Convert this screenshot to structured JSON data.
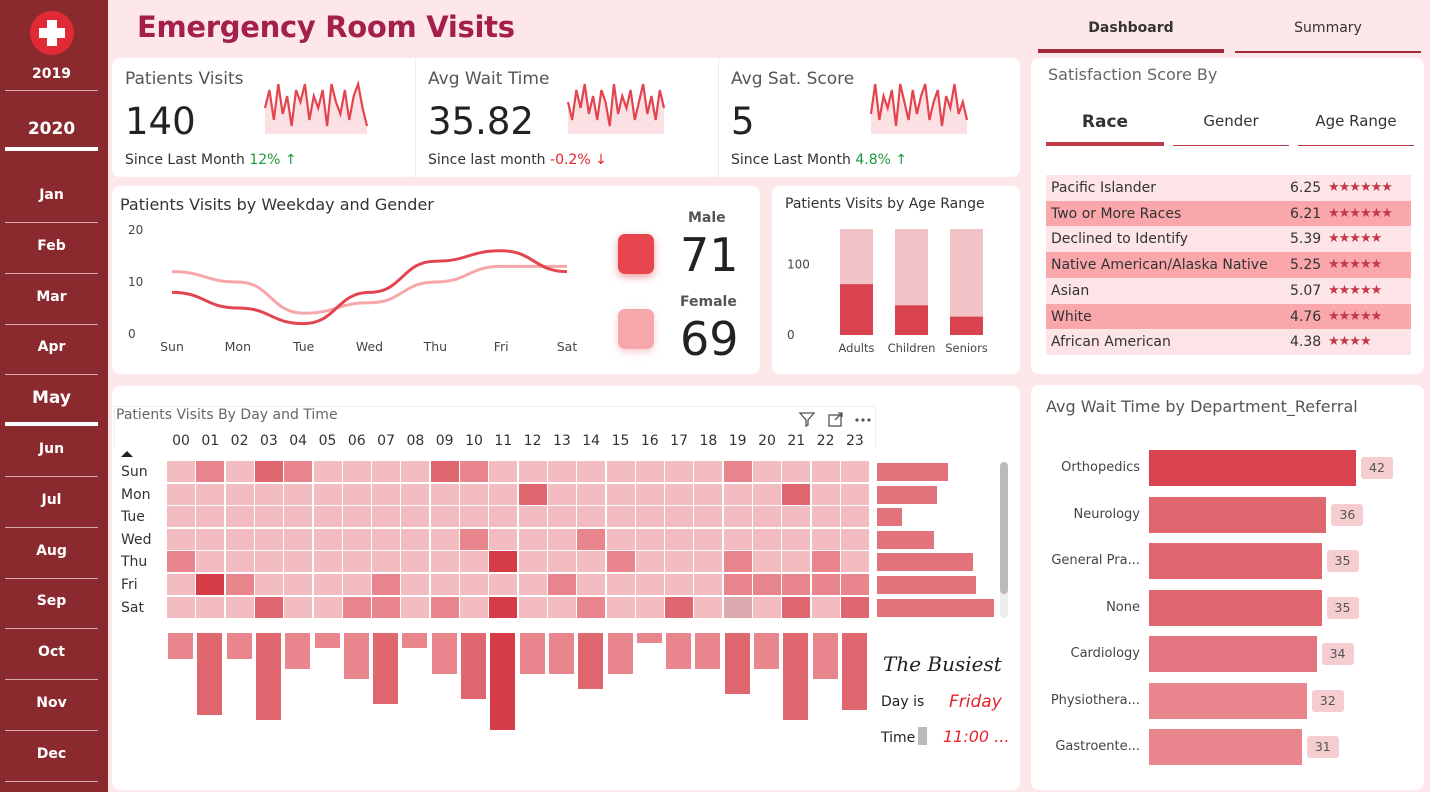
{
  "sidebar": {
    "years": [
      "2019",
      "2020"
    ],
    "selected_year": "2020",
    "months": [
      "Jan",
      "Feb",
      "Mar",
      "Apr",
      "May",
      "Jun",
      "Jul",
      "Aug",
      "Sep",
      "Oct",
      "Nov",
      "Dec"
    ],
    "selected_month": "May"
  },
  "header": {
    "title": "Emergency Room Visits",
    "tabs": [
      "Dashboard",
      "Summary"
    ],
    "active_tab": "Dashboard"
  },
  "kpis": [
    {
      "label": "Patients Visits",
      "value": "140",
      "sub": "Since Last Month",
      "change": "12% ↑",
      "trend": "up"
    },
    {
      "label": "Avg Wait Time",
      "value": "35.82",
      "sub": "Since last month",
      "change": "-0.2% ↓",
      "trend": "down"
    },
    {
      "label": "Avg Sat. Score",
      "value": "5",
      "sub": "Since Last Month",
      "change": "4.8% ↑",
      "trend": "up"
    }
  ],
  "gender_card": {
    "male_label": "Male",
    "male_value": "71",
    "female_label": "Female",
    "female_value": "69"
  },
  "heatmap": {
    "title": "Patients Visits By Day and Time",
    "hours": [
      "00",
      "01",
      "02",
      "03",
      "04",
      "05",
      "06",
      "07",
      "08",
      "09",
      "10",
      "11",
      "12",
      "13",
      "14",
      "15",
      "16",
      "17",
      "18",
      "19",
      "20",
      "21",
      "22",
      "23"
    ],
    "days": [
      "Sun",
      "Mon",
      "Tue",
      "Wed",
      "Thu",
      "Fri",
      "Sat"
    ],
    "values": [
      [
        1,
        2,
        1,
        3,
        2,
        1,
        1,
        1,
        1,
        3,
        2,
        1,
        1,
        1,
        1,
        1,
        1,
        1,
        1,
        2,
        1,
        1,
        1,
        1
      ],
      [
        1,
        1,
        1,
        1,
        1,
        1,
        1,
        1,
        1,
        1,
        1,
        1,
        3,
        1,
        1,
        1,
        1,
        1,
        1,
        1,
        1,
        3,
        1,
        1
      ],
      [
        1,
        1,
        1,
        1,
        1,
        1,
        1,
        1,
        1,
        1,
        1,
        1,
        1,
        1,
        1,
        1,
        1,
        1,
        1,
        1,
        1,
        1,
        1,
        1
      ],
      [
        1,
        1,
        1,
        1,
        1,
        1,
        1,
        1,
        1,
        1,
        2,
        1,
        1,
        1,
        2,
        1,
        1,
        1,
        1,
        1,
        1,
        1,
        1,
        1
      ],
      [
        2,
        1,
        1,
        1,
        1,
        1,
        1,
        1,
        1,
        1,
        1,
        4,
        1,
        1,
        1,
        2,
        1,
        1,
        1,
        2,
        1,
        1,
        2,
        1
      ],
      [
        1,
        4,
        2,
        1,
        1,
        1,
        1,
        2,
        1,
        1,
        1,
        1,
        1,
        2,
        1,
        1,
        1,
        1,
        1,
        2,
        2,
        2,
        2,
        2
      ],
      [
        1,
        1,
        1,
        3,
        1,
        1,
        2,
        2,
        1,
        2,
        1,
        4,
        1,
        1,
        2,
        1,
        1,
        3,
        1,
        0,
        1,
        3,
        1,
        3
      ]
    ],
    "row_totals": [
      20,
      17,
      7,
      16,
      27,
      28,
      33
    ],
    "col_totals": [
      5,
      16,
      5,
      17,
      7,
      3,
      9,
      14,
      3,
      8,
      13,
      19,
      8,
      8,
      11,
      8,
      2,
      7,
      7,
      12,
      7,
      17,
      9,
      15
    ],
    "busiest_title": "The Busiest",
    "day_label": "Day is",
    "day_value": "Friday",
    "time_label": "Time",
    "time_value": "11:00 ..."
  },
  "satisfaction": {
    "title": "Satisfaction Score By",
    "tabs": [
      "Race",
      "Gender",
      "Age Range"
    ],
    "active_tab": "Race",
    "rows": [
      {
        "name": "Pacific Islander",
        "score": "6.25",
        "stars": "★★★★★★"
      },
      {
        "name": "Two or More Races",
        "score": "6.21",
        "stars": "★★★★★★"
      },
      {
        "name": "Declined to Identify",
        "score": "5.39",
        "stars": "★★★★★"
      },
      {
        "name": "Native American/Alaska Native",
        "score": "5.25",
        "stars": "★★★★★"
      },
      {
        "name": "Asian",
        "score": "5.07",
        "stars": "★★★★★"
      },
      {
        "name": "White",
        "score": "4.76",
        "stars": "★★★★★"
      },
      {
        "name": "African American",
        "score": "4.38",
        "stars": "★★★★"
      }
    ]
  },
  "icons": [
    "hospital-cross-icon",
    "filter-icon",
    "focus-mode-icon",
    "more-options-icon",
    "sort-ascending-icon"
  ],
  "colors": {
    "dark_red": "#8b2a2e",
    "accent": "#d9434f",
    "light": "#f5a7aa",
    "page_bg": "#fde7e8",
    "title": "#a3204d"
  },
  "chart_data": [
    {
      "type": "line",
      "title": "Patients Visits by Weekday and Gender",
      "categories": [
        "Sun",
        "Mon",
        "Tue",
        "Wed",
        "Thu",
        "Fri",
        "Sat"
      ],
      "ylim": [
        0,
        20
      ],
      "yticks": [
        0,
        10,
        20
      ],
      "series": [
        {
          "name": "Male",
          "values": [
            8,
            5,
            2,
            8,
            14,
            16,
            12
          ]
        },
        {
          "name": "Female",
          "values": [
            12,
            10,
            4,
            6,
            10,
            13,
            13
          ]
        }
      ]
    },
    {
      "type": "bar",
      "title": "Patients Visits by Age Range",
      "categories": [
        "Adults",
        "Children",
        "Seniors"
      ],
      "values": [
        72,
        42,
        26
      ],
      "background": 150,
      "ylim": [
        0,
        150
      ],
      "yticks": [
        0,
        100
      ]
    },
    {
      "type": "bar",
      "orientation": "horizontal",
      "title": "Avg Wait Time by Department_Referral",
      "categories": [
        "Orthopedics",
        "Neurology",
        "General Pra...",
        "None",
        "Cardiology",
        "Physiothera...",
        "Gastroente..."
      ],
      "values": [
        42,
        36,
        35,
        35,
        34,
        32,
        31
      ]
    },
    {
      "type": "line",
      "title": "",
      "series": [
        {
          "name": "",
          "values": [
            5,
            8,
            3,
            9,
            4,
            7,
            2,
            8,
            6,
            9,
            3,
            7,
            5,
            8,
            2,
            9,
            6,
            4,
            8,
            3,
            7,
            9,
            5,
            2
          ]
        }
      ]
    },
    {
      "type": "line",
      "title": "",
      "series": [
        {
          "name": "",
          "values": [
            6,
            3,
            8,
            5,
            9,
            4,
            7,
            3,
            8,
            6,
            2,
            9,
            4,
            7,
            5,
            8,
            3,
            6,
            9,
            4,
            7,
            3,
            8,
            5
          ]
        }
      ]
    },
    {
      "type": "line",
      "title": "",
      "series": [
        {
          "name": "",
          "values": [
            4,
            9,
            3,
            7,
            5,
            8,
            2,
            9,
            6,
            3,
            8,
            4,
            7,
            9,
            3,
            6,
            8,
            2,
            7,
            5,
            9,
            4,
            6,
            3
          ]
        }
      ]
    }
  ]
}
